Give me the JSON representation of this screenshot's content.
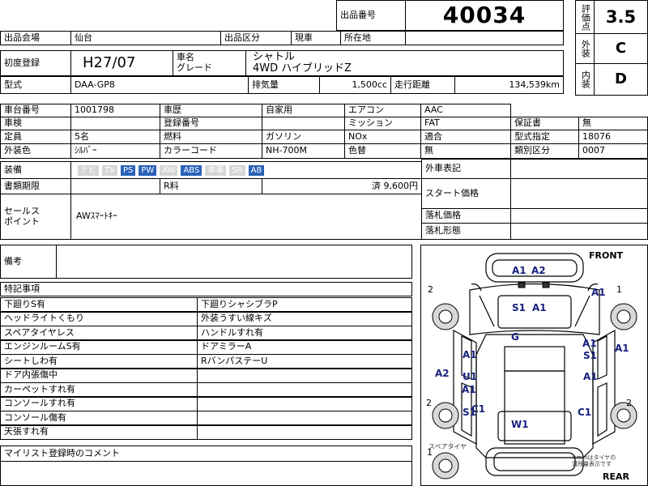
{
  "header": {
    "lot_label": "出品番号",
    "lot_number": "40034",
    "score_label": "評価点",
    "score": "3.5",
    "ext_label": "外装",
    "ext_grade": "C",
    "int_label": "内装",
    "int_grade": "D"
  },
  "row1": {
    "venue_label": "出品会場",
    "venue": "仙台",
    "category_label": "出品区分",
    "category": "現車",
    "location_label": "所在地",
    "location": ""
  },
  "row2": {
    "reg_label": "初度登録",
    "reg": "H27/07",
    "name_label": "車名\nグレード",
    "name": "シャトル\n4WD ハイブリッドZ"
  },
  "row3": {
    "model_label": "型式",
    "model": "DAA-GP8",
    "displacement_label": "排気量",
    "displacement": "1,500cc",
    "mileage_label": "走行距離",
    "mileage": "134,539km"
  },
  "spec": {
    "chassis_label": "車台番号",
    "chassis": "1001798",
    "history_label": "車歴",
    "history": "自家用",
    "ac_label": "エアコン",
    "ac": "AAC",
    "inspection_label": "車検",
    "inspection": "",
    "plate_label": "登録番号",
    "plate": "",
    "transmission_label": "ミッション",
    "transmission": "FAT",
    "warranty_label": "保証書",
    "warranty": "無",
    "capacity_label": "定員",
    "capacity": "5名",
    "fuel_label": "燃料",
    "fuel": "ガソリン",
    "nox": "NOx",
    "conform_label": "適合",
    "conform": "",
    "type_no_label": "型式指定",
    "type_no": "18076",
    "color_label": "外装色",
    "color": "ｼﾙﾊﾞｰ",
    "color_code_label": "カラーコード",
    "color_code": "NH-700M",
    "color_change_label": "色替",
    "color_change": "無",
    "class_label": "類別区分",
    "class_no": "0007",
    "equipment_label": "装備",
    "equipment": [
      {
        "t": "ナビ",
        "on": false
      },
      {
        "t": "TV",
        "on": false
      },
      {
        "t": "PS",
        "on": true
      },
      {
        "t": "PW",
        "on": true
      },
      {
        "t": "AW",
        "on": false
      },
      {
        "t": "ABS",
        "on": true
      },
      {
        "t": "本革",
        "on": false
      },
      {
        "t": "SR",
        "on": false
      },
      {
        "t": "AB",
        "on": true
      }
    ],
    "docs_label": "書類期限",
    "docs": "",
    "recycle_label": "R料",
    "recycle": "済 9,600円"
  },
  "right_panel": {
    "foreign_label": "外車表記",
    "start_label": "スタート価格",
    "won_price_label": "落札価格",
    "won_type_label": "落札形態"
  },
  "sales": {
    "label": "セールス\nポイント",
    "text": "AWｽﾏｰﾄｷｰ"
  },
  "remarks": {
    "label": "備考"
  },
  "notes": {
    "title": "特記事項",
    "left": [
      "下廻りS有",
      "ヘッドライトくもり",
      "スペアタイヤレス",
      "エンジンルームS有",
      "シートしわ有",
      "ドア内張傷中",
      "カーペットすれ有",
      "コンソールすれ有",
      "コンソール傷有",
      "天張すれ有"
    ],
    "right": [
      "下廻りシャシブラP",
      "外装うすい線キズ",
      "ハンドルすれ有",
      "ドアミラーA",
      "RバンパステーU"
    ]
  },
  "comment": {
    "label": "マイリスト登録時のコメント"
  },
  "diagram": {
    "front": "FRONT",
    "rear": "REAR",
    "spare": "スペアタイヤ",
    "note": "※mmはタイヤの\n溝残量表示です",
    "tire_mm": [
      "2",
      "1",
      "2",
      "2",
      "1"
    ],
    "marks": [
      "A1",
      "A2",
      "A1",
      "S1",
      "A1",
      "G",
      "A1",
      "A1",
      "A1",
      "S1",
      "A1",
      "A2",
      "U1",
      "A1",
      "S1",
      "C1",
      "W1",
      "C1"
    ]
  }
}
